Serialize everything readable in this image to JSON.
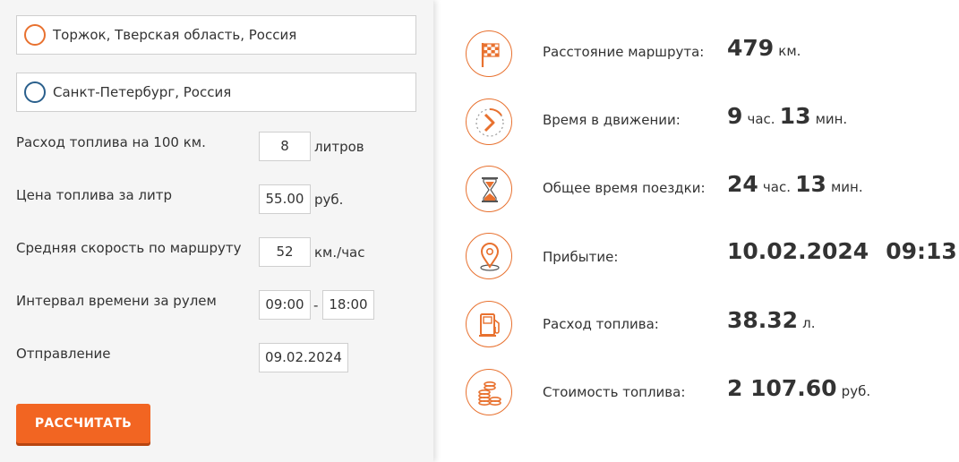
{
  "route": {
    "from": "Торжок, Тверская область, Россия",
    "to": "Санкт-Петербург, Россия"
  },
  "params": {
    "fuel_consumption": {
      "label": "Расход топлива на 100 км.",
      "value": "8",
      "unit": "литров"
    },
    "fuel_price": {
      "label": "Цена топлива за литр",
      "value": "55.00",
      "unit": "руб."
    },
    "avg_speed": {
      "label": "Средняя скорость по маршруту",
      "value": "52",
      "unit": "км./час"
    },
    "drive_interval": {
      "label": "Интервал времени за рулем",
      "start": "09:00",
      "separator": "-",
      "end": "18:00"
    },
    "departure": {
      "label": "Отправление",
      "value": "09.02.2024"
    }
  },
  "calculate_button": "РАССЧИТАТЬ",
  "results": {
    "distance": {
      "label": "Расстояние маршрута:",
      "value": "479",
      "unit": "км."
    },
    "drive_time": {
      "label": "Время в движении:",
      "hours": "9",
      "hours_unit": "час.",
      "minutes": "13",
      "minutes_unit": "мин."
    },
    "total_time": {
      "label": "Общее время поездки:",
      "hours": "24",
      "hours_unit": "час.",
      "minutes": "13",
      "minutes_unit": "мин."
    },
    "arrival": {
      "label": "Прибытие:",
      "date": "10.02.2024",
      "time": "09:13"
    },
    "fuel_used": {
      "label": "Расход топлива:",
      "value": "38.32",
      "unit": "л."
    },
    "fuel_cost": {
      "label": "Стоимость топлива:",
      "value": "2 107.60",
      "unit": "руб."
    }
  },
  "icons": {
    "distance": "checkered-flag-icon",
    "drive_time": "clock-arrow-icon",
    "total_time": "hourglass-icon",
    "arrival": "location-pin-icon",
    "fuel_used": "fuel-pump-icon",
    "fuel_cost": "coins-stack-icon"
  },
  "colors": {
    "accent": "#f26522",
    "from_marker": "#e8712f",
    "to_marker": "#2a5f8c",
    "panel_bg": "#f5f5f5"
  }
}
